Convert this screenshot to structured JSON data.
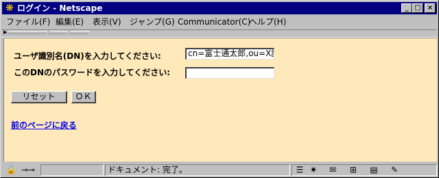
{
  "window": {
    "title": "ログイン - Netscape",
    "minimize": "_",
    "maximize": "□",
    "close": "×"
  },
  "menu": [
    {
      "label": "ファイル(F)"
    },
    {
      "label": "編集(E)"
    },
    {
      "label": "表示(V)"
    },
    {
      "label": "ジャンプ(G)"
    },
    {
      "label": "Communicator(C)"
    },
    {
      "label": "ヘルプ(H)"
    }
  ],
  "form": {
    "dn_label": "ユーザ識別名(DN)を入力してください:",
    "dn_value": "cn=富士通太郎,ou=X課",
    "password_label": "このDNのパスワードを入力してください:",
    "password_value": "",
    "reset_label": "リセット",
    "ok_label": "ＯＫ"
  },
  "back_link": "前のページに戻る",
  "status": {
    "message": "ドキュメント: 完了。"
  },
  "icons": {
    "app": "netscape-icon",
    "security": "lock-icon",
    "connection": "plug-icon"
  }
}
